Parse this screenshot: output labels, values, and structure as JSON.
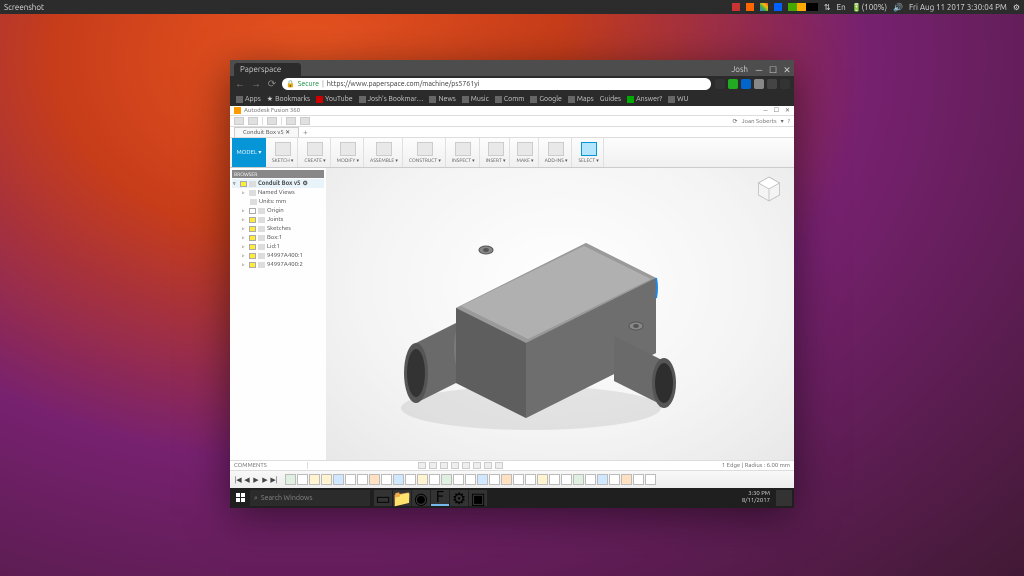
{
  "ubuntu": {
    "title": "Screenshot",
    "battery": "(100%)",
    "lang": "En",
    "datetime": "Fri Aug 11 2017  3:30:04 PM"
  },
  "chrome": {
    "tab_title": "Paperspace",
    "win_user": "Josh",
    "secure_label": "Secure",
    "url": "https://www.paperspace.com/machine/ps5761yi",
    "bookmarks": [
      "Apps",
      "Bookmarks",
      "YouTube",
      "Josh's Bookmar…",
      "News",
      "Music",
      "Comm",
      "Google",
      "Maps",
      "Guides",
      "Answer?",
      "WU"
    ]
  },
  "fusion": {
    "app_title": "Autodesk Fusion 360",
    "user": "Joan Soberts",
    "doc_tab": "Conduit Box v5",
    "model_btn": "MODEL ▾",
    "ribbon": [
      "SKETCH ▾",
      "CREATE ▾",
      "MODIFY ▾",
      "ASSEMBLE ▾",
      "CONSTRUCT ▾",
      "INSPECT ▾",
      "INSERT ▾",
      "MAKE ▾",
      "ADD-INS ▾",
      "SELECT ▾"
    ],
    "browser_header": "BROWSER",
    "browser": {
      "root": "Conduit Box v5",
      "items": [
        {
          "label": "Named Views",
          "lvl": 1
        },
        {
          "label": "Units: mm",
          "lvl": 2
        },
        {
          "label": "Origin",
          "lvl": 1
        },
        {
          "label": "Joints",
          "lvl": 1
        },
        {
          "label": "Sketches",
          "lvl": 1
        },
        {
          "label": "Box:1",
          "lvl": 1
        },
        {
          "label": "Lid:1",
          "lvl": 1
        },
        {
          "label": "94997A400:1",
          "lvl": 1
        },
        {
          "label": "94997A400:2",
          "lvl": 1
        }
      ]
    },
    "comments": "COMMENTS",
    "measure": "1 Edge | Radius : 6.00 mm"
  },
  "windows": {
    "search_placeholder": "Search Windows",
    "time": "3:30 PM",
    "date": "8/11/2017"
  }
}
